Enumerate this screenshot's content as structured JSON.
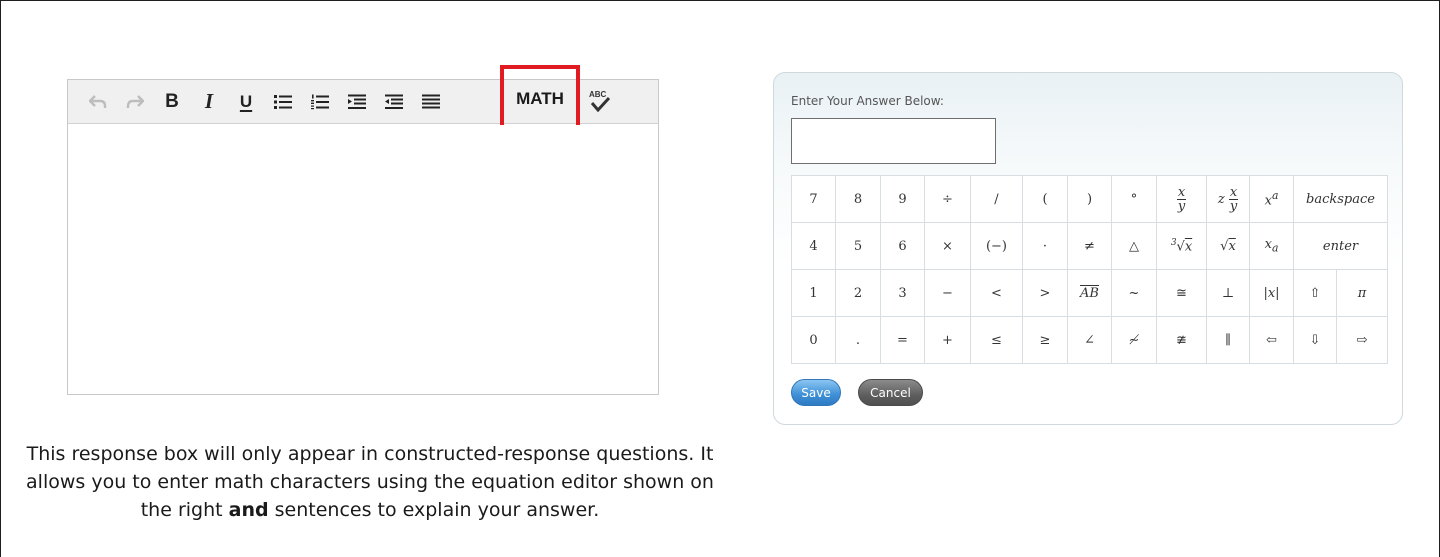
{
  "editor": {
    "toolbar": {
      "undo_icon": "undo-icon",
      "redo_icon": "redo-icon",
      "bold_label": "B",
      "italic_label": "I",
      "underline_label": "U",
      "math_label": "MATH",
      "spellcheck_label": "ABC"
    },
    "highlight_color": "#e11b22"
  },
  "caption": {
    "part1": "This response box will only appear in constructed-response questions. It allows you to enter math characters using the equation editor shown on the right ",
    "bold": "and",
    "part2": " sentences to explain your answer."
  },
  "equation_editor": {
    "label": "Enter Your Answer Below:",
    "input_value": "",
    "rows": [
      [
        "7",
        "8",
        "9",
        "÷",
        "/",
        "(",
        ")",
        "°",
        "x/y",
        "z x/y",
        "xᵃ",
        "backspace"
      ],
      [
        "4",
        "5",
        "6",
        "×",
        "(−)",
        "·",
        "≠",
        "△",
        "∛x",
        "√x",
        "xₐ",
        "enter"
      ],
      [
        "1",
        "2",
        "3",
        "−",
        "<",
        ">",
        "AB",
        "~",
        "≅",
        "⊥",
        "|x|",
        "⇧",
        "π"
      ],
      [
        "0",
        ".",
        "=",
        "+",
        "≤",
        "≥",
        "∠",
        "≁",
        "≇",
        "∥",
        "⇦",
        "⇩",
        "⇨"
      ]
    ],
    "save_label": "Save",
    "cancel_label": "Cancel",
    "accent": "#3d8fd6"
  }
}
